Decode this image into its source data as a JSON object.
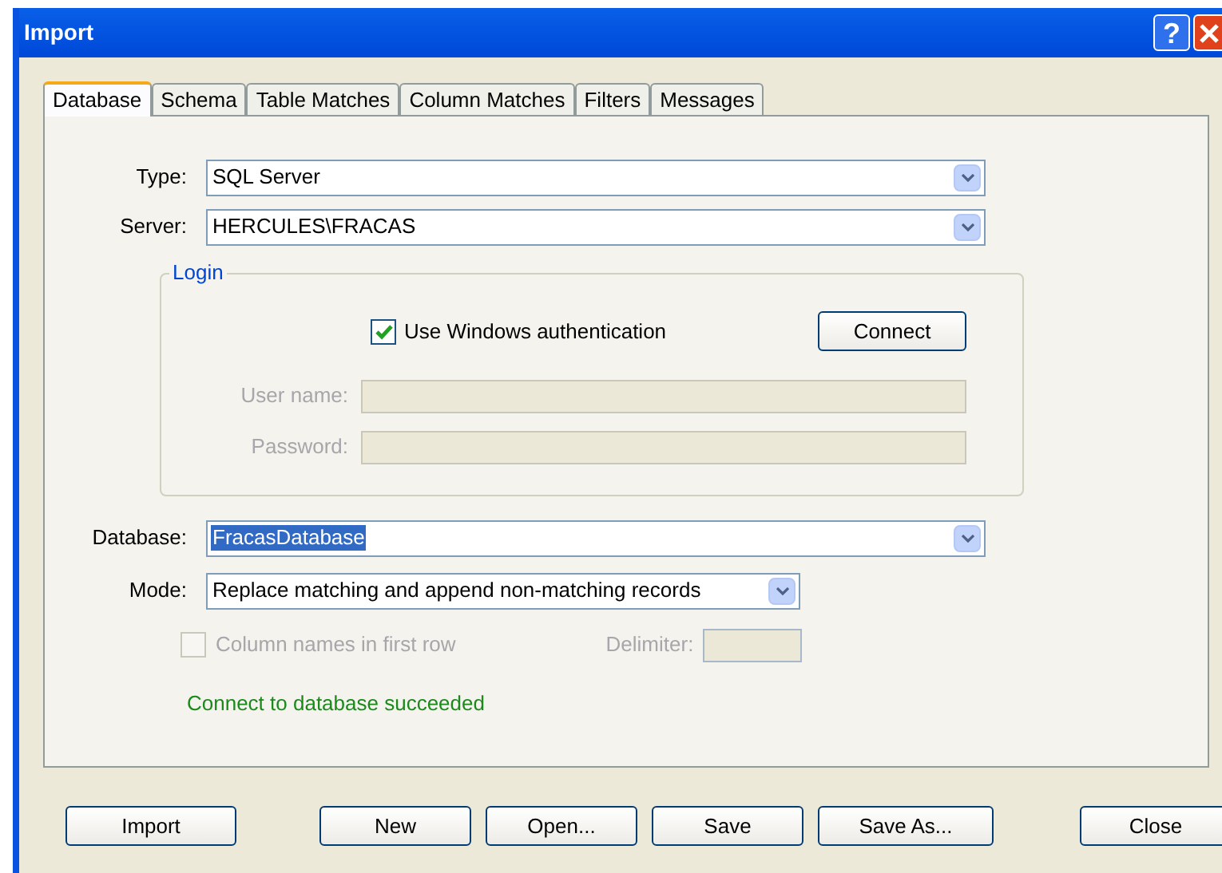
{
  "window": {
    "title": "Import",
    "help_button": "?"
  },
  "tabs": [
    {
      "label": "Database",
      "selected": true
    },
    {
      "label": "Schema",
      "selected": false
    },
    {
      "label": "Table Matches",
      "selected": false
    },
    {
      "label": "Column Matches",
      "selected": false
    },
    {
      "label": "Filters",
      "selected": false
    },
    {
      "label": "Messages",
      "selected": false
    }
  ],
  "type": {
    "label": "Type:",
    "value": "SQL Server"
  },
  "server": {
    "label": "Server:",
    "value": "HERCULES\\FRACAS"
  },
  "login": {
    "title": "Login",
    "windows_auth": {
      "label": "Use Windows authentication",
      "checked": true,
      "disabled": false
    },
    "connect_button": "Connect",
    "fields": [
      {
        "label": "User name:",
        "disabled": true
      },
      {
        "label": "Password:",
        "disabled": true
      }
    ]
  },
  "database": {
    "label": "Database:",
    "value": "FracasDatabase",
    "text_selected": true
  },
  "mode": {
    "label": "Mode:",
    "value": "Replace matching and append non-matching records"
  },
  "column_names": {
    "label": "Column names in first row",
    "checked": false,
    "disabled": true
  },
  "delimiter": {
    "label": "Delimiter:",
    "disabled": true
  },
  "status": "Connect to database succeeded",
  "buttons": [
    "Import",
    "New",
    "Open...",
    "Save",
    "Save As...",
    "Close"
  ]
}
